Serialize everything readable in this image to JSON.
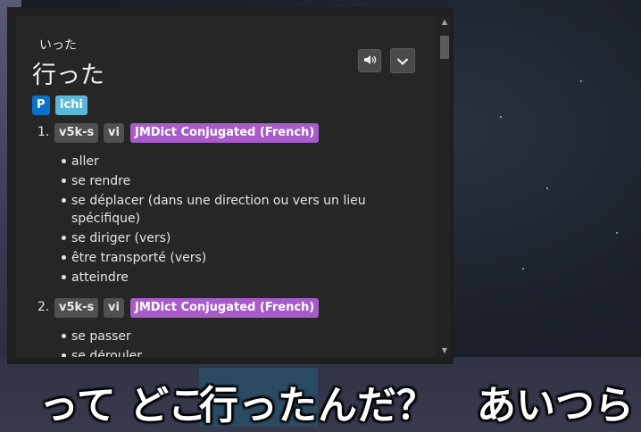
{
  "popup": {
    "reading": "いった",
    "headword": "行った",
    "tags": [
      "P",
      "ichi"
    ],
    "senses": [
      {
        "number": "1.",
        "tags": [
          "v5k-s",
          "vi",
          "JMDict Conjugated (French)"
        ],
        "glosses": [
          "aller",
          "se rendre",
          "se déplacer (dans une direction ou vers un lieu",
          "spécifique)",
          "se diriger (vers)",
          "être transporté (vers)",
          "atteindre"
        ]
      },
      {
        "number": "2.",
        "tags": [
          "v5k-s",
          "vi",
          "JMDict Conjugated (French)"
        ],
        "glosses": [
          "se passer",
          "se dérouler"
        ]
      }
    ],
    "buttons": {
      "audio_icon": "speaker-icon",
      "menu_icon": "chevron-down-icon"
    }
  },
  "subtitle": {
    "before": "って どこ",
    "highlighted": "行った",
    "after": "んだ？",
    "extra": "あいつら"
  },
  "colors": {
    "tag_popular": "#0a72c8",
    "tag_ichi": "#5bb8d6",
    "tag_dictionary": "#a85bc9",
    "subtitle_highlight": "#2b4b63"
  }
}
